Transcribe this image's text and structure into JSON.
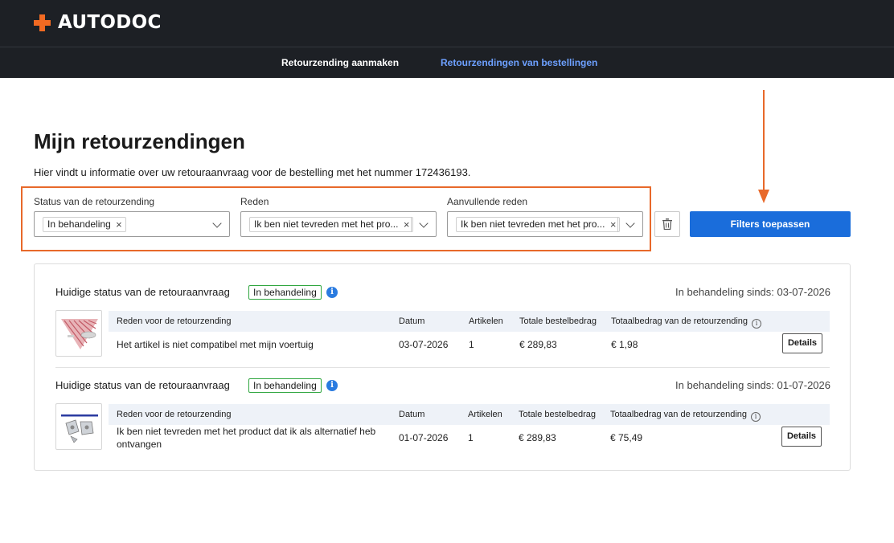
{
  "header": {
    "brand": "AUTODOC",
    "nav": {
      "create_label": "Retourzending aanmaken",
      "orders_label": "Retourzendingen van bestellingen"
    }
  },
  "page": {
    "title": "Mijn retourzendingen",
    "intro": "Hier vindt u informatie over uw retouraanvraag voor de bestelling met het nummer 172436193."
  },
  "filters": {
    "status": {
      "label": "Status van de retourzending",
      "selected": "In behandeling"
    },
    "reason": {
      "label": "Reden",
      "selected": "Ik ben niet tevreden met het pro..."
    },
    "extra_reason": {
      "label": "Aanvullende reden",
      "selected": "Ik ben niet tevreden met het pro..."
    },
    "apply_label": "Filters toepassen"
  },
  "table_headers": {
    "reason": "Reden voor de retourzending",
    "date": "Datum",
    "items": "Artikelen",
    "order_total": "Totale bestelbedrag",
    "return_total": "Totaalbedrag van de retourzending"
  },
  "returns": [
    {
      "status_label": "Huidige status van de retouraanvraag",
      "status": "In behandeling",
      "since": "In behandeling sinds: 03-07-2026",
      "reason": "Het artikel is niet compatibel met mijn voertuig",
      "date": "03-07-2026",
      "items": "1",
      "order_total": "€ 289,83",
      "return_total": "€ 1,98",
      "details_label": "Details"
    },
    {
      "status_label": "Huidige status van de retouraanvraag",
      "status": "In behandeling",
      "since": "In behandeling sinds: 01-07-2026",
      "reason_line1": "Ik ben niet tevreden met het product dat ik als alternatief heb",
      "reason_line2": "ontvangen",
      "date": "01-07-2026",
      "items": "1",
      "order_total": "€ 289,83",
      "return_total": "€ 75,49",
      "details_label": "Details"
    }
  ],
  "colors": {
    "topbar": "#1d2025",
    "accent_orange": "#e8692a",
    "primary_blue": "#1a6ddb",
    "nav_active": "#6da0ff",
    "badge_green": "#2fa63f"
  }
}
